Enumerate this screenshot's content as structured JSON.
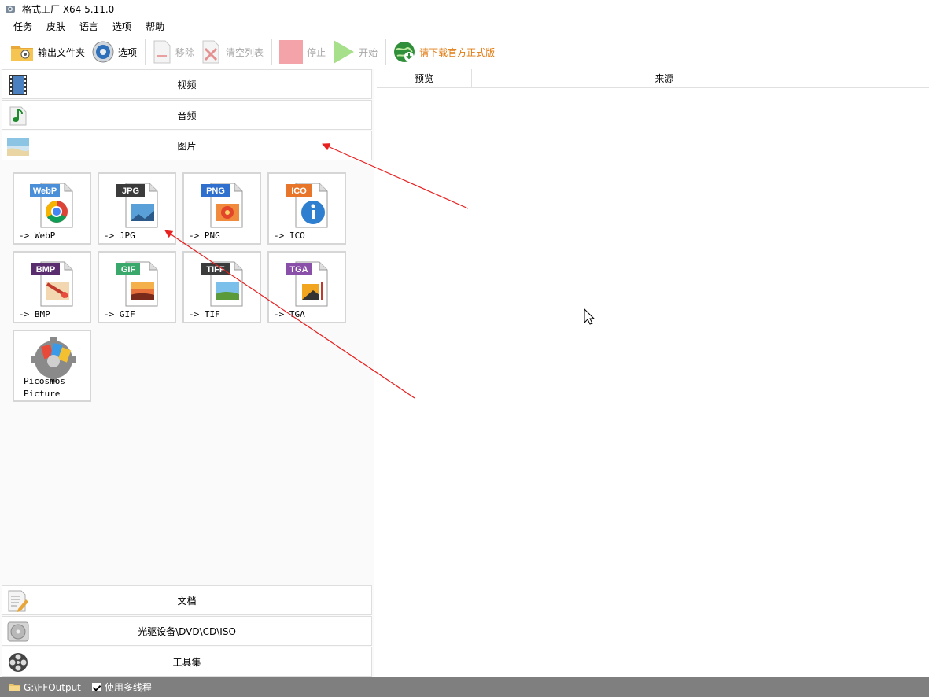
{
  "window": {
    "title": "格式工厂 X64 5.11.0"
  },
  "menu": {
    "items": [
      "任务",
      "皮肤",
      "语言",
      "选项",
      "帮助"
    ]
  },
  "toolbar": {
    "output_folder": "输出文件夹",
    "options": "选项",
    "remove": "移除",
    "clear_list": "清空列表",
    "stop": "停止",
    "start": "开始",
    "download_official": "请下载官方正式版"
  },
  "categories": {
    "video": "视频",
    "audio": "音频",
    "picture": "图片",
    "document": "文档",
    "disc": "光驱设备\\DVD\\CD\\ISO",
    "toolbox": "工具集"
  },
  "formats": [
    {
      "badge": "WebP",
      "caption": "-> WebP",
      "badge_color": "#4a8fd8"
    },
    {
      "badge": "JPG",
      "caption": "-> JPG",
      "badge_color": "#3b3b3b"
    },
    {
      "badge": "PNG",
      "caption": "-> PNG",
      "badge_color": "#2f6fce"
    },
    {
      "badge": "ICO",
      "caption": "-> ICO",
      "badge_color": "#e8762a"
    },
    {
      "badge": "BMP",
      "caption": "-> BMP",
      "badge_color": "#5a2d6e"
    },
    {
      "badge": "GIF",
      "caption": "-> GIF",
      "badge_color": "#3aa86a"
    },
    {
      "badge": "TIFF",
      "caption": "-> TIF",
      "badge_color": "#3b3b3b"
    },
    {
      "badge": "TGA",
      "caption": "-> TGA",
      "badge_color": "#8a4fa8"
    }
  ],
  "picosmos": {
    "caption": "Picosmos\nPicture"
  },
  "table": {
    "columns": [
      "预览",
      "来源"
    ]
  },
  "status": {
    "output_path": "G:\\FFOutput",
    "multithread": "使用多线程"
  },
  "colors": {
    "arrow": "#e82020",
    "statusbar": "#7f7f7f"
  }
}
